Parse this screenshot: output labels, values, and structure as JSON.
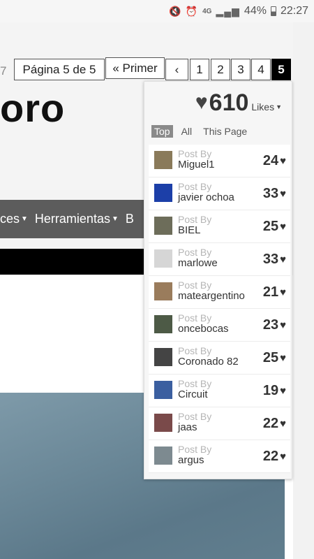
{
  "status_bar": {
    "icons": "🔇 ⏰",
    "network": "4G",
    "signal": "▂▄▆",
    "battery_percent": "44%",
    "time": "22:27"
  },
  "pagination": {
    "cut_text": "7",
    "page_info": "Página 5 de 5",
    "first": "« Primer",
    "prev": "‹",
    "pages": [
      "1",
      "2",
      "3",
      "4",
      "5"
    ],
    "current": "5"
  },
  "site_title": "oro",
  "nav": {
    "items": [
      "ces",
      "Herramientas",
      "B"
    ]
  },
  "likes": {
    "total": "610",
    "label": "Likes",
    "tabs": [
      "Top",
      "All",
      "This Page"
    ],
    "active_tab": "Top",
    "items": [
      {
        "post_by": "Post By",
        "name": "Miguel1",
        "count": "24",
        "avatar_color": "#8a7a5a"
      },
      {
        "post_by": "Post By",
        "name": "javier ochoa",
        "count": "33",
        "avatar_color": "#1c3fa8"
      },
      {
        "post_by": "Post By",
        "name": "BIEL",
        "count": "25",
        "avatar_color": "#6d6d5a"
      },
      {
        "post_by": "Post By",
        "name": "marlowe",
        "count": "33",
        "avatar_color": "#d6d6d6"
      },
      {
        "post_by": "Post By",
        "name": "mateargentino",
        "count": "21",
        "avatar_color": "#9a7c5c"
      },
      {
        "post_by": "Post By",
        "name": "oncebocas",
        "count": "23",
        "avatar_color": "#4d5a46"
      },
      {
        "post_by": "Post By",
        "name": "Coronado 82",
        "count": "25",
        "avatar_color": "#444444"
      },
      {
        "post_by": "Post By",
        "name": "Circuit",
        "count": "19",
        "avatar_color": "#3b5fa0"
      },
      {
        "post_by": "Post By",
        "name": "jaas",
        "count": "22",
        "avatar_color": "#7a4a4a"
      },
      {
        "post_by": "Post By",
        "name": "argus",
        "count": "22",
        "avatar_color": "#7d8a90"
      }
    ]
  }
}
